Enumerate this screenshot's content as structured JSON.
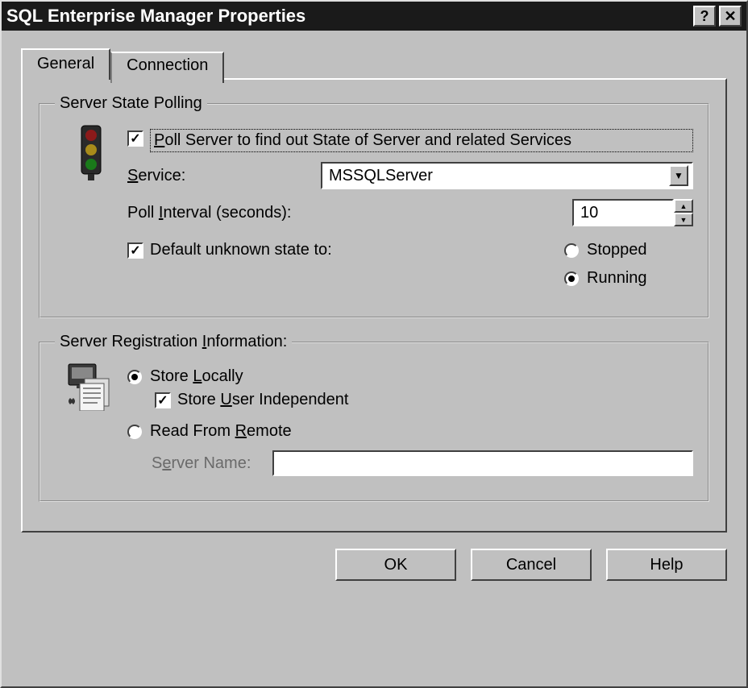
{
  "title": "SQL Enterprise Manager Properties",
  "tabs": {
    "general": "General",
    "connection": "Connection"
  },
  "polling": {
    "legend": "Server State Polling",
    "poll_checkbox_html": "<span class='underline'>P</span>oll Server to find out State of Server and related Services",
    "poll_checkbox_checked": true,
    "service_label_html": "<span class='underline'>S</span>ervice:",
    "service_value": "MSSQLServer",
    "interval_label_html": "Poll <span class='underline'>I</span>nterval (seconds):",
    "interval_value": "10",
    "default_state_checked": true,
    "default_state_label": "Default unknown state to:",
    "radio_stopped": "Stopped",
    "radio_running": "Running",
    "selected_state": "running"
  },
  "registration": {
    "legend_html": "Server Registration <span class='underline'>I</span>nformation:",
    "radio_local_html": "Store <span class='underline'>L</span>ocally",
    "store_user_independent_html": "Store <span class='underline'>U</span>ser Independent",
    "store_user_independent_checked": true,
    "radio_remote_html": "Read From <span class='underline'>R</span>emote",
    "server_name_label_html": "S<span class='underline'>e</span>rver Name:",
    "server_name_value": "",
    "selected": "local"
  },
  "buttons": {
    "ok": "OK",
    "cancel": "Cancel",
    "help": "Help"
  }
}
